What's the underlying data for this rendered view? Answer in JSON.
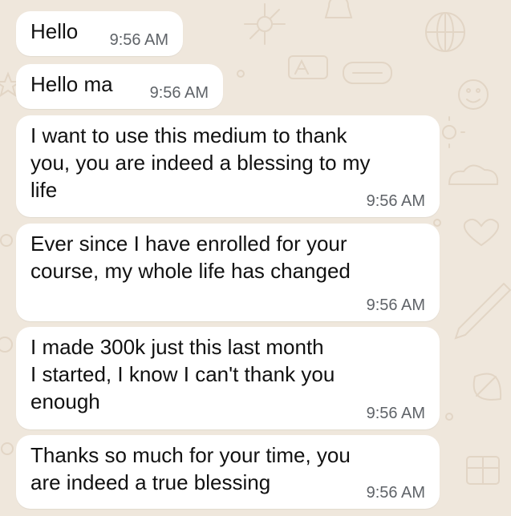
{
  "chat": {
    "colors": {
      "wallpaper": "#efe7dc",
      "bubble": "#ffffff",
      "text": "#111111",
      "timestamp": "#5f6368",
      "doodle": "#e2d5c5"
    },
    "messages": [
      {
        "text": "Hello",
        "time": "9:56 AM"
      },
      {
        "text": "Hello ma",
        "time": "9:56 AM"
      },
      {
        "text": "I want to use this medium to thank\nyou, you are indeed a blessing to my\nlife",
        "time": "9:56 AM"
      },
      {
        "text": "Ever since I have enrolled for your\ncourse, my whole life has changed",
        "time": "9:56 AM"
      },
      {
        "text": "I made 300k just this last month\nI started, I know I can't thank you\nenough",
        "time": "9:56 AM"
      },
      {
        "text": "Thanks so much for your time, you\nare indeed a true blessing",
        "time": "9:56 AM"
      }
    ]
  }
}
